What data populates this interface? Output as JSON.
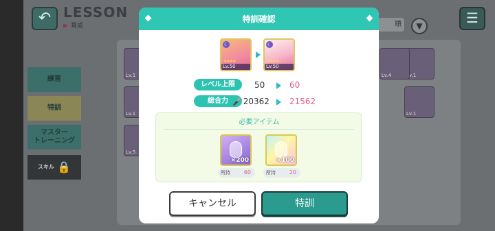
{
  "background": {
    "title": "LESSON",
    "subtitle": "育成",
    "sort_label": "順",
    "tabs": [
      {
        "label": "練習"
      },
      {
        "label": "特訓"
      },
      {
        "label": "マスター\nトレーニング"
      },
      {
        "label": "スキル"
      }
    ],
    "card_levels": [
      "Lv.1",
      "Lv.1",
      "Lv.5",
      "Lv.1",
      "Lv.1",
      "Lv.4"
    ],
    "icons": {
      "back": "back-arrow-icon",
      "menu": "hamburger-menu-icon",
      "lock": "lock-icon",
      "sort": "chevron-down-icon"
    }
  },
  "dialog": {
    "title": "特訓確認",
    "card_before": {
      "level": "Lv.50"
    },
    "card_after": {
      "level": "Lv.50"
    },
    "stats": [
      {
        "label": "レベル上限",
        "old": "50",
        "new": "60"
      },
      {
        "label": "総合力",
        "old": "20362",
        "new": "21562"
      }
    ],
    "items_section_title": "必要アイテム",
    "items": [
      {
        "qty": "×200",
        "owned_label": "所持",
        "owned_count": "60"
      },
      {
        "qty": "×100",
        "owned_label": "所持",
        "owned_count": "20"
      }
    ],
    "cancel_label": "キャンセル",
    "confirm_label": "特訓"
  },
  "colors": {
    "accent": "#2fc6b4",
    "new_value": "#e25c86"
  }
}
